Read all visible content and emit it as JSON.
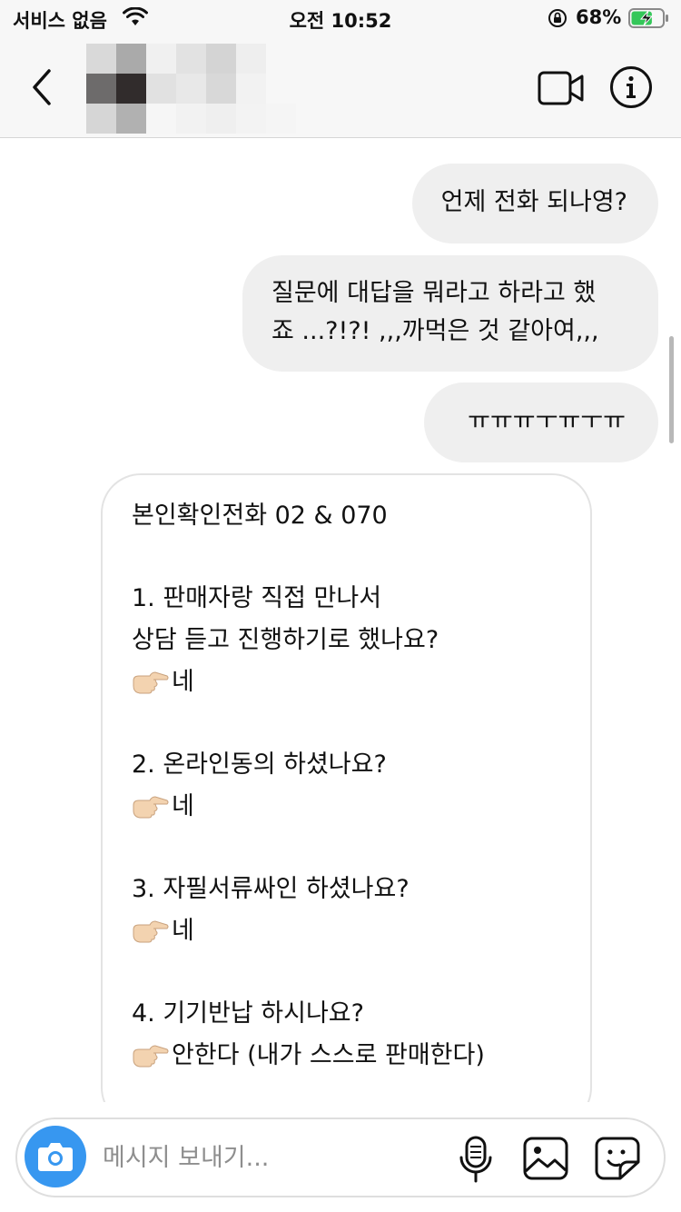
{
  "status_bar": {
    "carrier": "서비스 없음",
    "time": "오전 10:52",
    "battery_percent": "68%",
    "battery_level": 0.68,
    "icons": [
      "wifi-icon",
      "orientation-lock-icon",
      "battery-charging-icon"
    ]
  },
  "header": {
    "icons": [
      "chevron-left-icon",
      "video-camera-icon",
      "info-icon"
    ]
  },
  "messages": {
    "outgoing": [
      {
        "lines": [
          "언제 전화 되나영?"
        ]
      },
      {
        "lines": [
          "질문에 대답을 뭐라고 하라고 했",
          "죠 ...?!?! ,,,까먹은 것 같아여,,,"
        ]
      },
      {
        "lines": [
          "ㅠㅠㅠㅜㅠㅜㅠ"
        ]
      }
    ],
    "incoming": {
      "title": "본인확인전화 02 & 070",
      "q1_a": "1. 판매자랑 직접 만나서",
      "q1_b": "상담 듣고 진행하기로 했나요?",
      "a1": "네",
      "q2": "2. 온라인동의 하셨나요?",
      "a2": "네",
      "q3": "3. 자필서류싸인 하셨나요?",
      "a3": "네",
      "q4": "4. 기기반납 하시나요?",
      "a4": "안한다 (내가 스스로 판매한다)"
    }
  },
  "composer": {
    "placeholder": "메시지 보내기...",
    "icons": [
      "camera-icon",
      "microphone-icon",
      "gallery-icon",
      "sticker-icon"
    ]
  },
  "colors": {
    "accent": "#3797f0",
    "bubble_out": "#efefef",
    "bubble_in_border": "#e3e3e3",
    "header_bg": "#f7f7f7"
  }
}
